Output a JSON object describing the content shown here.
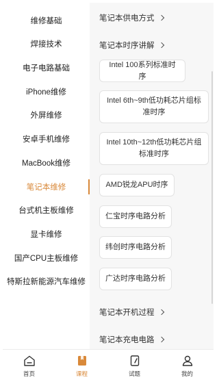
{
  "sidebar": {
    "items": [
      {
        "label": "维修基础",
        "active": false
      },
      {
        "label": "焊接技术",
        "active": false
      },
      {
        "label": "电子电路基础",
        "active": false
      },
      {
        "label": "iPhone维修",
        "active": false
      },
      {
        "label": "外屏维修",
        "active": false
      },
      {
        "label": "安卓手机维修",
        "active": false
      },
      {
        "label": "MacBook维修",
        "active": false
      },
      {
        "label": "笔记本维修",
        "active": true
      },
      {
        "label": "台式机主板维修",
        "active": false
      },
      {
        "label": "显卡维修",
        "active": false
      },
      {
        "label": "国产CPU主板维修",
        "active": false
      },
      {
        "label": "特斯拉新能源汽车维修",
        "active": false
      }
    ]
  },
  "content": {
    "section_power": "笔记本供电方式",
    "section_timing": "笔记本时序讲解",
    "timing_items": [
      "Intel 100系列标准时序",
      "Intel 6th~9th低功耗芯片组标准时序",
      "Intel 10th~12th低功耗芯片组标准时序",
      "AMD锐龙APU时序",
      "仁宝时序电路分析",
      "纬创时序电路分析",
      "广达时序电路分析"
    ],
    "section_boot": "笔记本开机过程",
    "section_charge": "笔记本充电电路"
  },
  "tabbar": {
    "tabs": [
      {
        "label": "首页",
        "icon": "home-icon",
        "active": false
      },
      {
        "label": "课程",
        "icon": "course-bookmark-icon",
        "active": true
      },
      {
        "label": "试题",
        "icon": "exam-paper-icon",
        "active": false
      },
      {
        "label": "我的",
        "icon": "profile-icon",
        "active": false
      }
    ]
  },
  "colors": {
    "accent": "#d9893a",
    "panel_bg": "#f7f7f7"
  }
}
